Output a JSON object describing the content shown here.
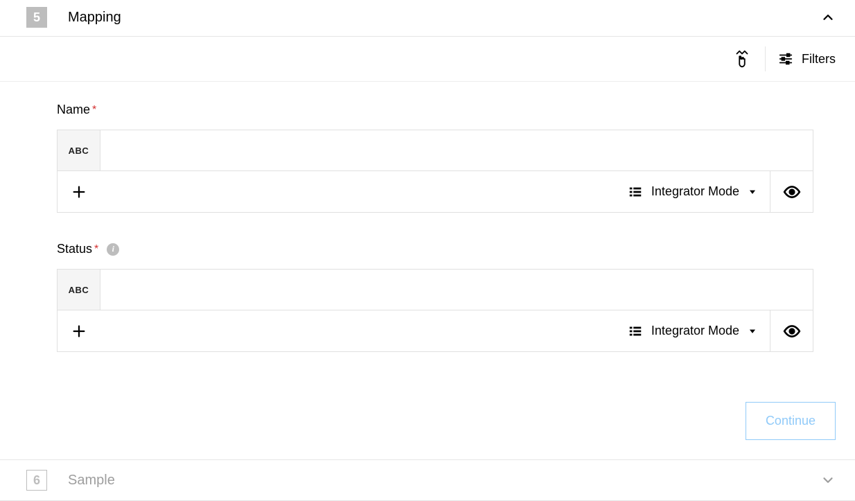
{
  "sections": {
    "mapping": {
      "step_number": "5",
      "title": "Mapping"
    },
    "sample": {
      "step_number": "6",
      "title": "Sample"
    }
  },
  "toolbar": {
    "filters_label": "Filters"
  },
  "fields": {
    "name": {
      "label": "Name",
      "type_badge": "ABC",
      "value": "",
      "mode_label": "Integrator Mode"
    },
    "status": {
      "label": "Status",
      "type_badge": "ABC",
      "value": "",
      "mode_label": "Integrator Mode"
    }
  },
  "actions": {
    "continue_label": "Continue"
  }
}
